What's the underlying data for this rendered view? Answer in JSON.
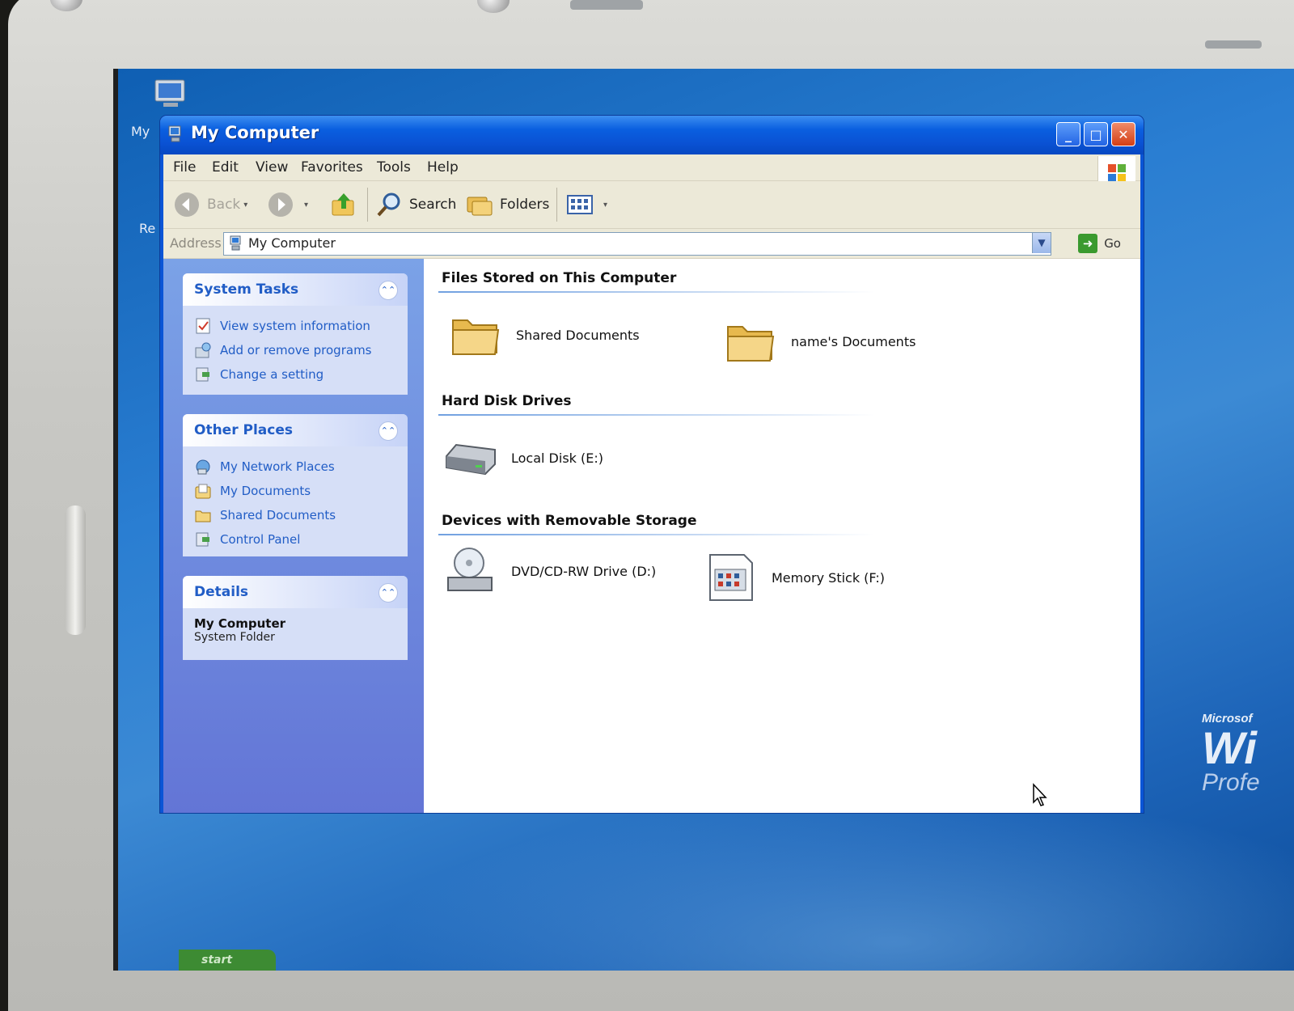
{
  "desktop": {
    "icon_labels": [
      "My",
      "Re"
    ],
    "brand": {
      "microsoft": "Microsof",
      "windows": "Wi",
      "edition": "Profe"
    }
  },
  "window": {
    "title": "My Computer",
    "controls": {
      "minimize": "_",
      "maximize": "□",
      "close": "✕"
    }
  },
  "menu": {
    "items": [
      "File",
      "Edit",
      "View",
      "Favorites",
      "Tools",
      "Help"
    ]
  },
  "toolbar": {
    "back_label": "Back",
    "search_label": "Search",
    "folders_label": "Folders"
  },
  "address": {
    "label": "Address",
    "value": "My Computer",
    "go_label": "Go"
  },
  "task_pane": {
    "system_tasks": {
      "title": "System Tasks",
      "links": [
        "View system information",
        "Add or remove programs",
        "Change a setting"
      ]
    },
    "other_places": {
      "title": "Other Places",
      "links": [
        "My Network Places",
        "My Documents",
        "Shared Documents",
        "Control Panel"
      ]
    },
    "details": {
      "title": "Details",
      "name": "My Computer",
      "type": "System Folder"
    }
  },
  "content": {
    "files_group": {
      "title": "Files Stored on This Computer",
      "items": [
        "Shared Documents",
        "name's Documents"
      ]
    },
    "hdd_group": {
      "title": "Hard Disk Drives",
      "items": [
        "Local Disk (E:)"
      ]
    },
    "removable_group": {
      "title": "Devices with Removable Storage",
      "items": [
        "DVD/CD-RW Drive (D:)",
        "Memory Stick (F:)"
      ]
    }
  },
  "taskbar": {
    "start_label": "start"
  },
  "colors": {
    "title_blue": "#0a52d4",
    "task_link_blue": "#215dc6",
    "client_beige": "#ece9d8",
    "close_red": "#d33e14"
  }
}
